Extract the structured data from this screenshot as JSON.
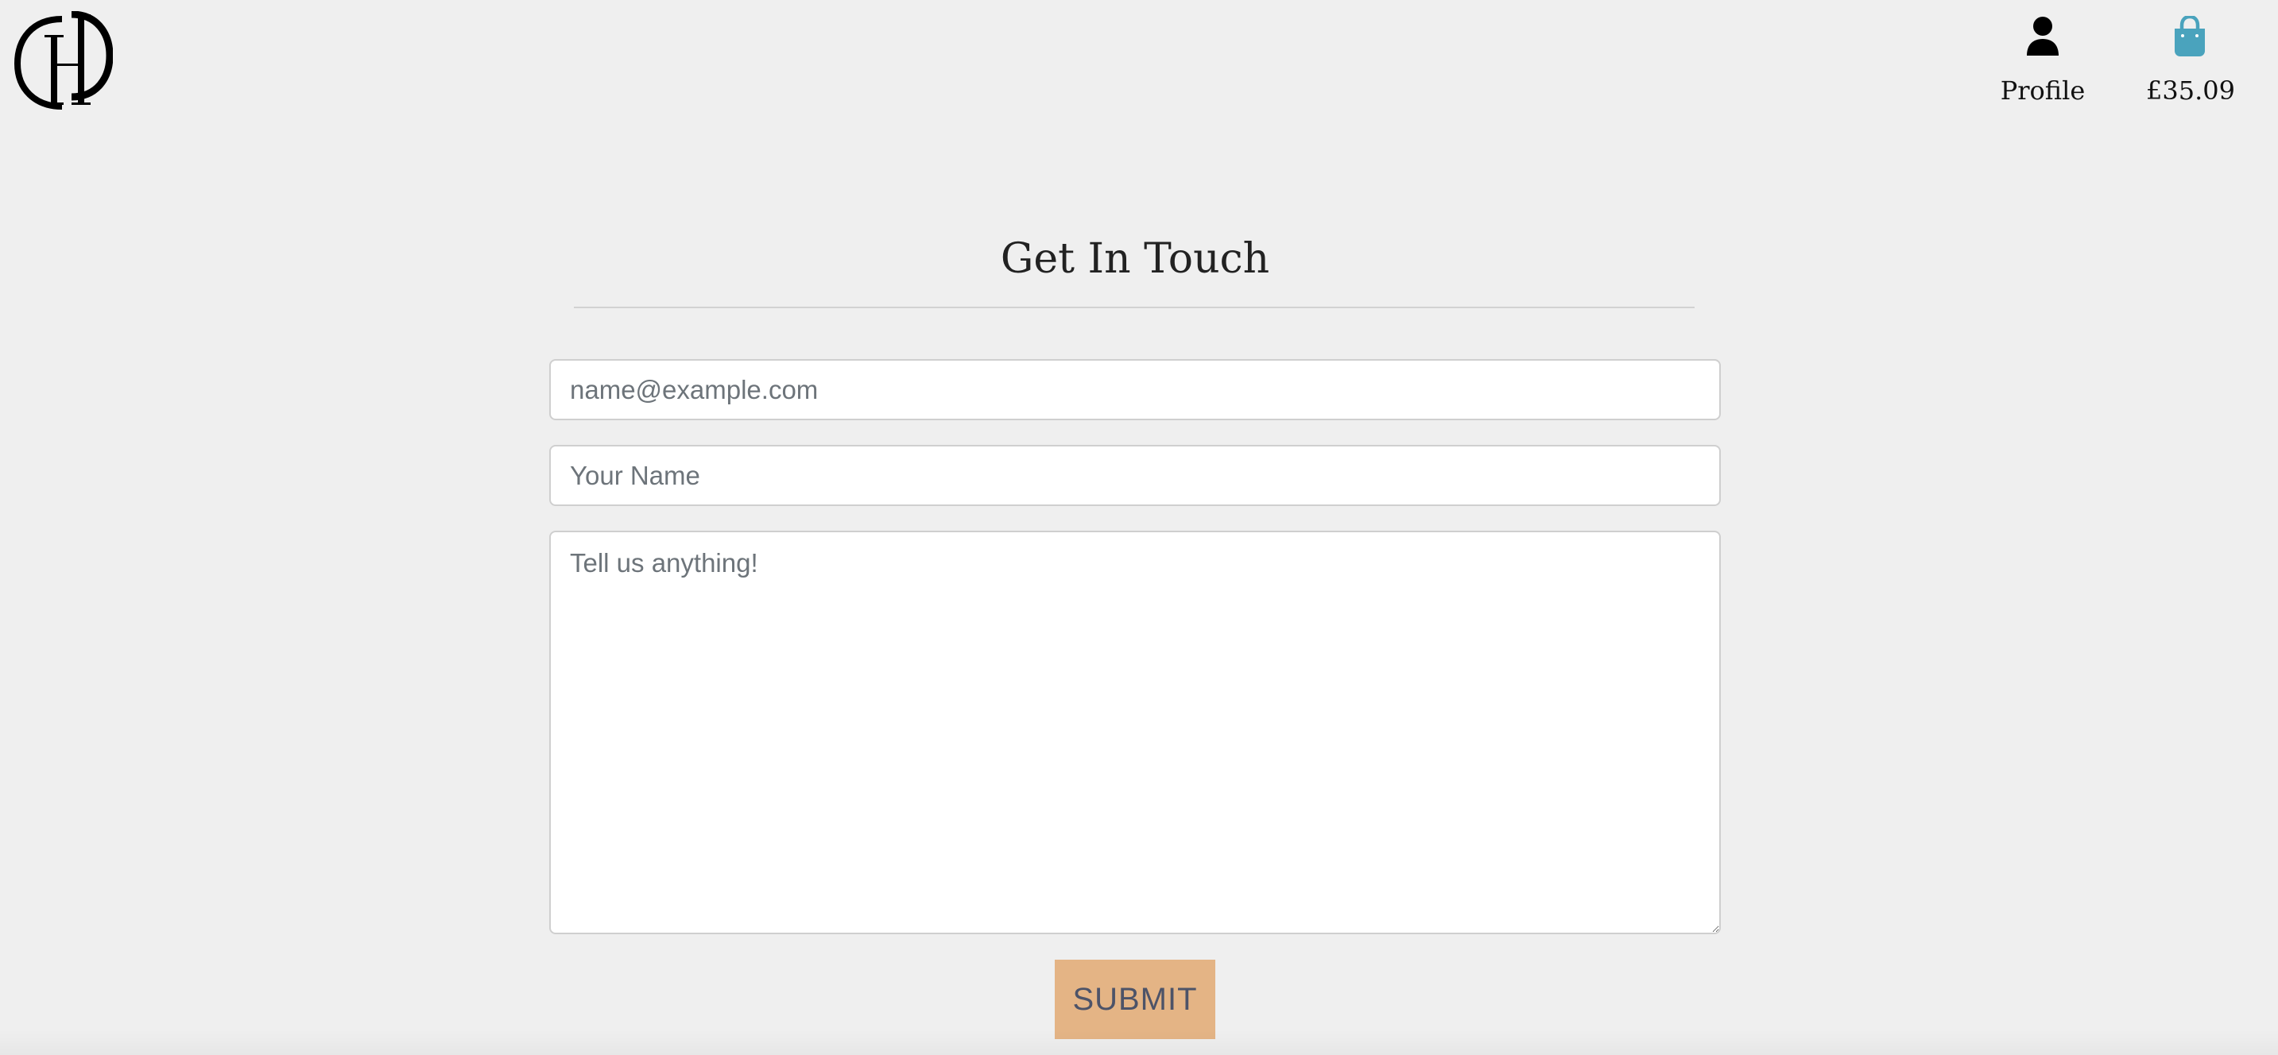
{
  "header": {
    "logo_icon": "dh-monogram-logo",
    "nav": {
      "profile": {
        "label": "Profile",
        "icon": "user-icon"
      },
      "bag": {
        "label": "£35.09",
        "icon": "shopping-bag-icon",
        "icon_color": "#4aa3bd"
      }
    }
  },
  "main": {
    "title": "Get In Touch",
    "form": {
      "email": {
        "placeholder": "name@example.com",
        "value": ""
      },
      "name": {
        "placeholder": "Your Name",
        "value": ""
      },
      "message": {
        "placeholder": "Tell us anything!",
        "value": ""
      },
      "submit_label": "SUBMIT"
    }
  },
  "colors": {
    "page_background": "#efefef",
    "submit_background": "#e4b485",
    "submit_text": "#4d5368",
    "bag_icon": "#4aa3bd"
  }
}
